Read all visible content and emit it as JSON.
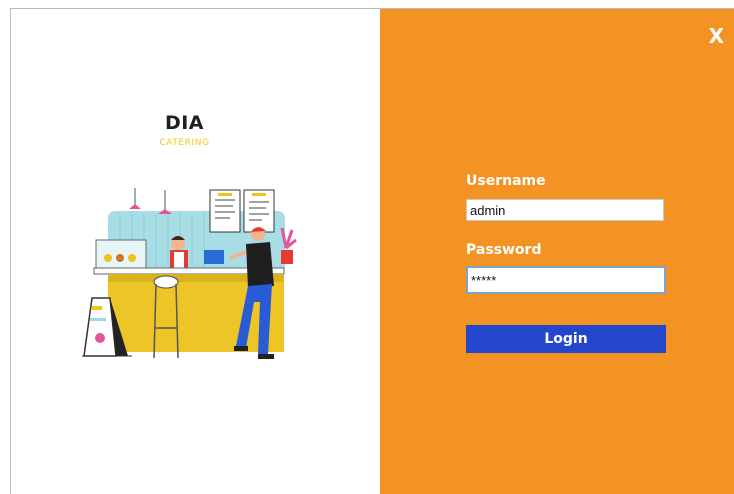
{
  "brand": {
    "title": "DIA",
    "subtitle": "CATERING"
  },
  "window": {
    "close_label": "X"
  },
  "login_form": {
    "username_label": "Username",
    "username_value": "admin",
    "password_label": "Password",
    "password_value": "*****",
    "login_label": "Login"
  },
  "colors": {
    "accent_orange": "#f39324",
    "button_blue": "#2346cc",
    "brand_yellow": "#f0c419"
  },
  "illustration": {
    "icon": "cafe-counter-illustration"
  }
}
